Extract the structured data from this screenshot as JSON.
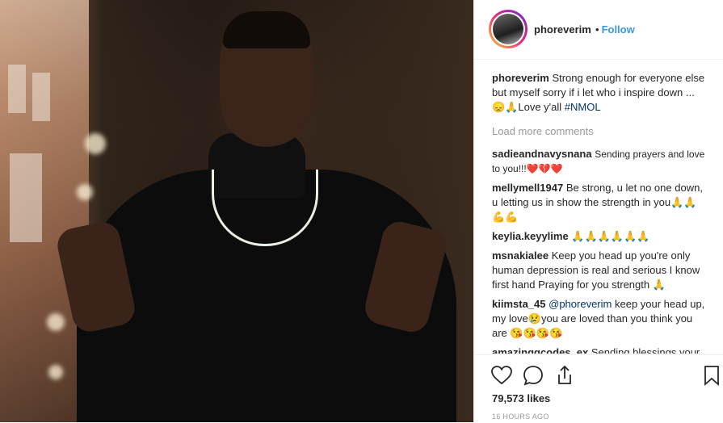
{
  "post": {
    "username": "phoreverim",
    "follow_separator": "•",
    "follow_label": "Follow",
    "caption": {
      "username": "phoreverim",
      "text": "Strong enough for everyone else but myself sorry if i let who i inspire down ... 😞🙏Love y'all",
      "hashtag": "#NMOL"
    },
    "load_more_label": "Load more comments",
    "comments": [
      {
        "username": "sadieandnavysnana",
        "text": "Sending prayers and love to you!!!❤️💔❤️"
      },
      {
        "username": "mellymell1947",
        "text": "Be strong, u let no one down, u letting us in show the strength in you🙏🙏💪💪"
      },
      {
        "username": "keylia.keyylime",
        "text": "🙏🙏🙏🙏🙏🙏"
      },
      {
        "username": "msnakialee",
        "text": "Keep you head up you're only human depression is real and serious I know first hand Praying for you strength 🙏"
      },
      {
        "username": "kiimsta_45",
        "mention": "@phoreverim",
        "text": "keep your head up, my love😢you are loved than you think you are 😘😘😘😘"
      },
      {
        "username": "amazinggcodes_ex",
        "text": "Sending blessings your"
      }
    ],
    "likes": "79,573 likes",
    "time": "16 HOURS AGO"
  },
  "icons": [
    "heart-icon",
    "comment-icon",
    "share-icon",
    "bookmark-icon"
  ],
  "colors": {
    "link": "#3897f0",
    "mention": "#003569",
    "muted": "#999999",
    "text": "#262626"
  }
}
